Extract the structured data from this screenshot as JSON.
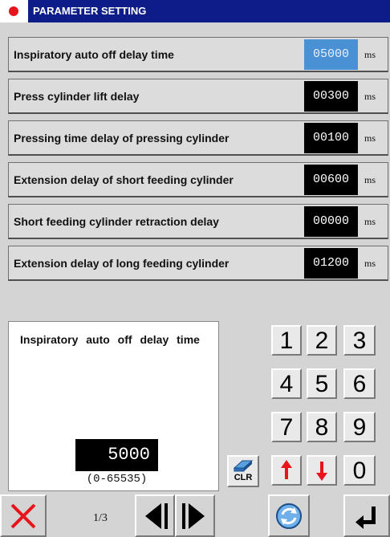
{
  "header": {
    "title": "PARAMETER SETTING"
  },
  "params": [
    {
      "label": "Inspiratory auto off delay time",
      "value": "05000",
      "unit": "ms"
    },
    {
      "label": "Press cylinder lift delay",
      "value": "00300",
      "unit": "ms"
    },
    {
      "label": "Pressing time delay of pressing cylinder",
      "value": "00100",
      "unit": "ms"
    },
    {
      "label": "Extension delay of short feeding cylinder",
      "value": "00600",
      "unit": "ms"
    },
    {
      "label": "Short feeding cylinder retraction delay",
      "value": "00000",
      "unit": "ms"
    },
    {
      "label": "Extension delay of long feeding cylinder",
      "value": "01200",
      "unit": "ms"
    }
  ],
  "info": {
    "title": "Inspiratory auto off delay time",
    "value": "5000",
    "range": "(0-65535)"
  },
  "keypad": {
    "k1": "1",
    "k2": "2",
    "k3": "3",
    "k4": "4",
    "k5": "5",
    "k6": "6",
    "k7": "7",
    "k8": "8",
    "k9": "9",
    "k0": "0",
    "clr": "CLR"
  },
  "footer": {
    "page": "1/3"
  },
  "colors": {
    "title_bg": "#0d1c88",
    "selected_value_bg": "#4a90d4",
    "indicator": "#e8141b",
    "arrow_red": "#e8141b"
  }
}
